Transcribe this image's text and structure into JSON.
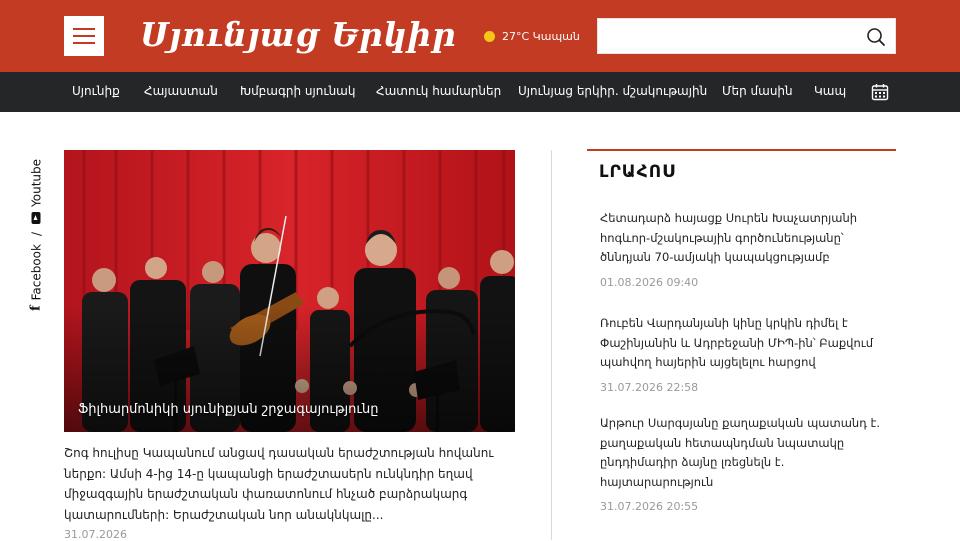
{
  "header": {
    "logo_text": "Սյունյաց Երկիր",
    "weather": "27°C Կապան",
    "search": {
      "placeholder": "",
      "value": ""
    }
  },
  "nav": {
    "items": [
      "Սյունիք",
      "Հայաստան",
      "Խմբագրի սյունակ",
      "Հատուկ համարներ",
      "Սյունյաց երկիր. մշակութային",
      "Մեր մասին",
      "Կապ"
    ]
  },
  "social": {
    "facebook": "Facebook",
    "separator": "/",
    "youtube": "Youtube"
  },
  "featured": {
    "caption": "Ֆիլհարմոնիկի սյունիքյան շրջագայությունը",
    "lead": "Շոգ հուլիսը Կապանում անցավ դասական երաժշտության հովանու ներքո: Ամսի 4-ից 14-ը կապանցի երաժշտասերն ունկնդիր եղավ միջազգային երաժշտական փառատոնում հնչած բարձրակարգ կատարումների: Երաժշտական նոր անակնկալը...",
    "date": "31.07.2026"
  },
  "sidebar": {
    "title": "ԼՐԱՀՈՍ",
    "items": [
      {
        "title": "Հետադարձ հայացք Սուրեն Խաչատրյանի հոգևոր-մշակութային գործունեությանը՝ ծննդյան 70-ամյակի կապակցությամբ",
        "date": "01.08.2026 09:40"
      },
      {
        "title": "Ռուբեն Վարդանյանի կինը կրկին դիմել է Փաշինյանին և Ադրբեջանի ՄԻՊ-ին՝ Բաքվում պահվող հայերին այցելելու հարցով",
        "date": "31.07.2026 22:58"
      },
      {
        "title": "Արթուր Սարգսյանը քաղաքական պատանդ է. քաղաքական հետապնդման նպատակը ընդդիմադիր ձայնը լռեցնելն է. հայտարարություն",
        "date": "31.07.2026 20:55"
      }
    ]
  },
  "colors": {
    "brand_red": "#c23b22",
    "nav_dark": "#242628",
    "weather_dot": "#f5c518"
  },
  "icons": {
    "menu": "hamburger-icon",
    "search": "search-icon",
    "calendar": "calendar-icon",
    "facebook": "facebook-icon",
    "youtube": "youtube-icon"
  }
}
